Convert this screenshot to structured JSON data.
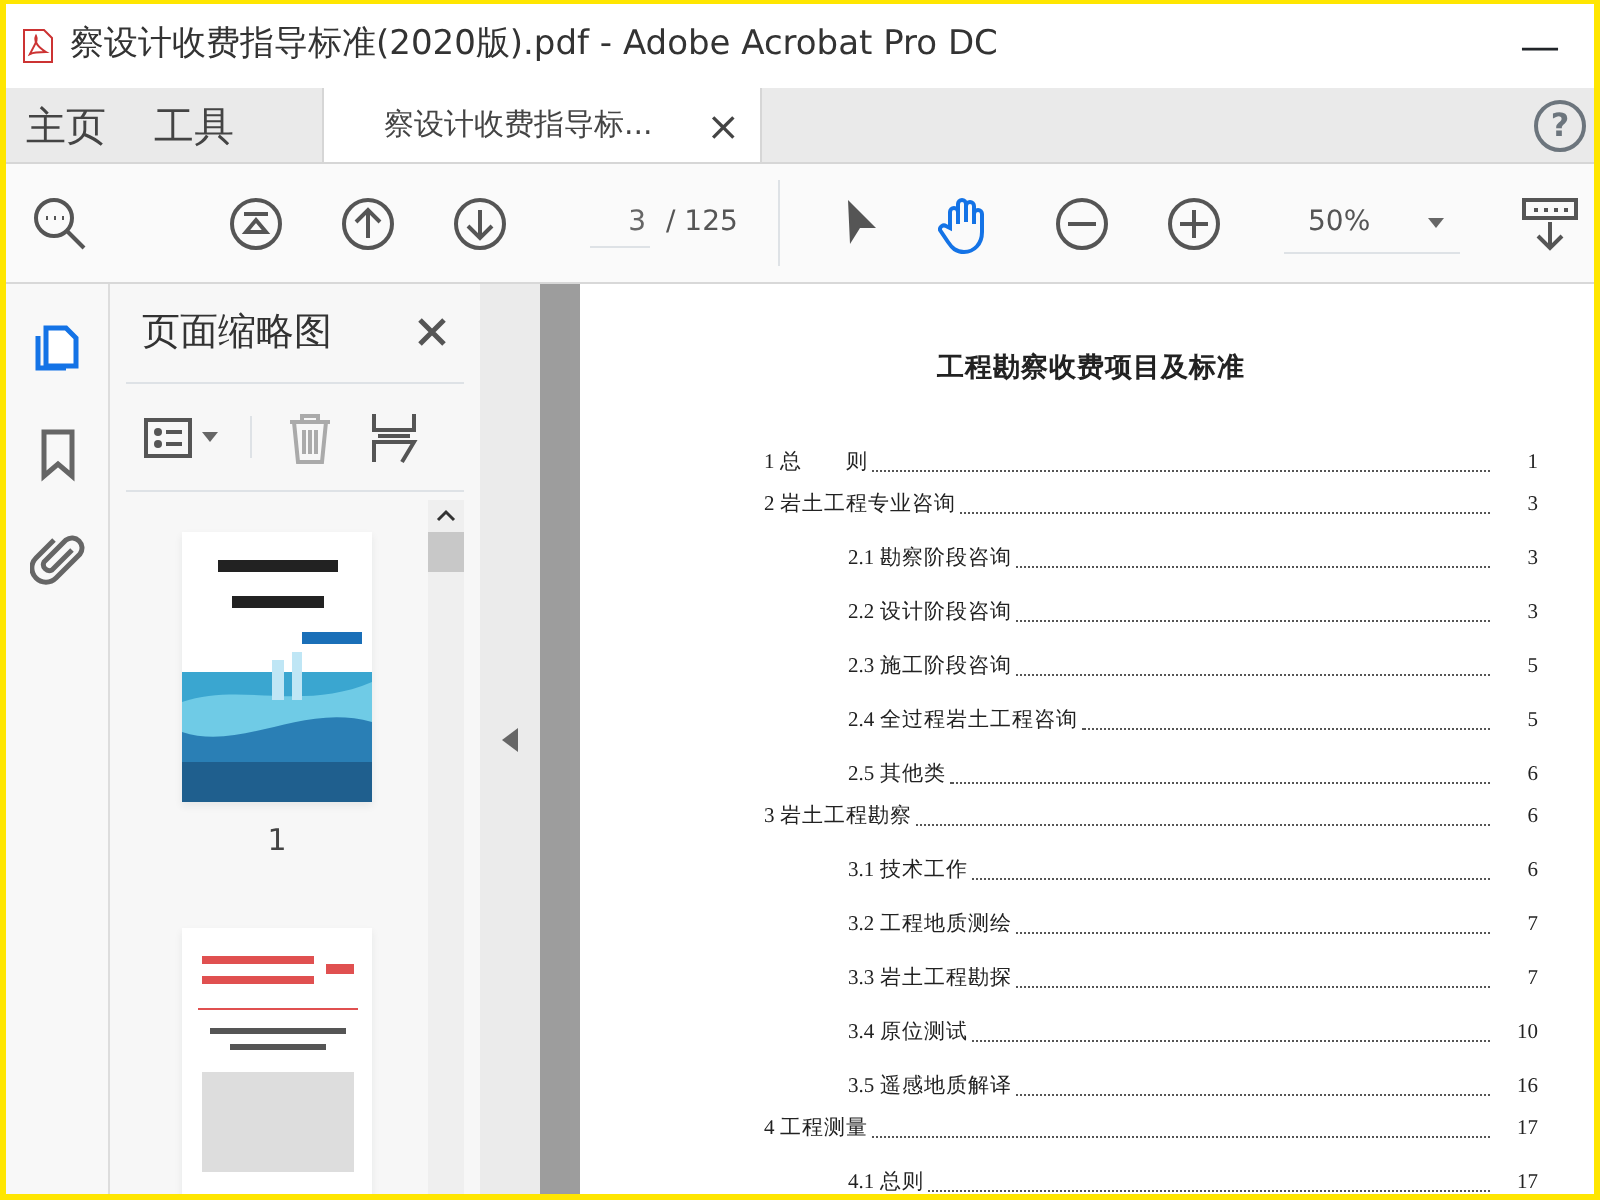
{
  "window": {
    "title": "察设计收费指导标准(2020版).pdf - Adobe Acrobat Pro DC",
    "minimize": "—"
  },
  "tabs": [
    {
      "label": "主页",
      "selected": false
    },
    {
      "label": "工具",
      "selected": false
    },
    {
      "label": "察设计收费指导标...",
      "selected": true,
      "close": "×"
    }
  ],
  "help": "?",
  "toolbar": {
    "page_input": "3",
    "page_total": "/ 125",
    "zoom": "50%",
    "hand_selected": true
  },
  "sidebar_tools": [
    {
      "kind": "pages",
      "selected": true
    },
    {
      "kind": "bookmark",
      "selected": false
    },
    {
      "kind": "attachment",
      "selected": false
    }
  ],
  "panel": {
    "title": "页面缩略图",
    "thumbnails": [
      {
        "kind": "picture",
        "label": "1"
      },
      {
        "kind": "picture"
      }
    ]
  },
  "document": {
    "heading": "工程勘察收费项目及标准",
    "toc": [
      {
        "label": "1 总　　则",
        "page": "1"
      },
      {
        "label": "2 岩土工程专业咨询",
        "page": "3",
        "children": [
          {
            "label": "2.1 勘察阶段咨询",
            "page": "3"
          },
          {
            "label": "2.2 设计阶段咨询",
            "page": "3"
          },
          {
            "label": "2.3 施工阶段咨询",
            "page": "5"
          },
          {
            "label": "2.4 全过程岩土工程咨询",
            "page": "5"
          },
          {
            "label": "2.5 其他类",
            "page": "6"
          }
        ]
      },
      {
        "label": "3 岩土工程勘察",
        "page": "6",
        "children": [
          {
            "label": "3.1 技术工作",
            "page": "6"
          },
          {
            "label": "3.2 工程地质测绘",
            "page": "7"
          },
          {
            "label": "3.3 岩土工程勘探",
            "page": "7"
          },
          {
            "label": "3.4 原位测试",
            "page": "10"
          },
          {
            "label": "3.5 遥感地质解译",
            "page": "16"
          }
        ]
      },
      {
        "label": "4 工程测量",
        "page": "17",
        "children": [
          {
            "label": "4.1 总则",
            "page": "17"
          }
        ]
      }
    ]
  }
}
